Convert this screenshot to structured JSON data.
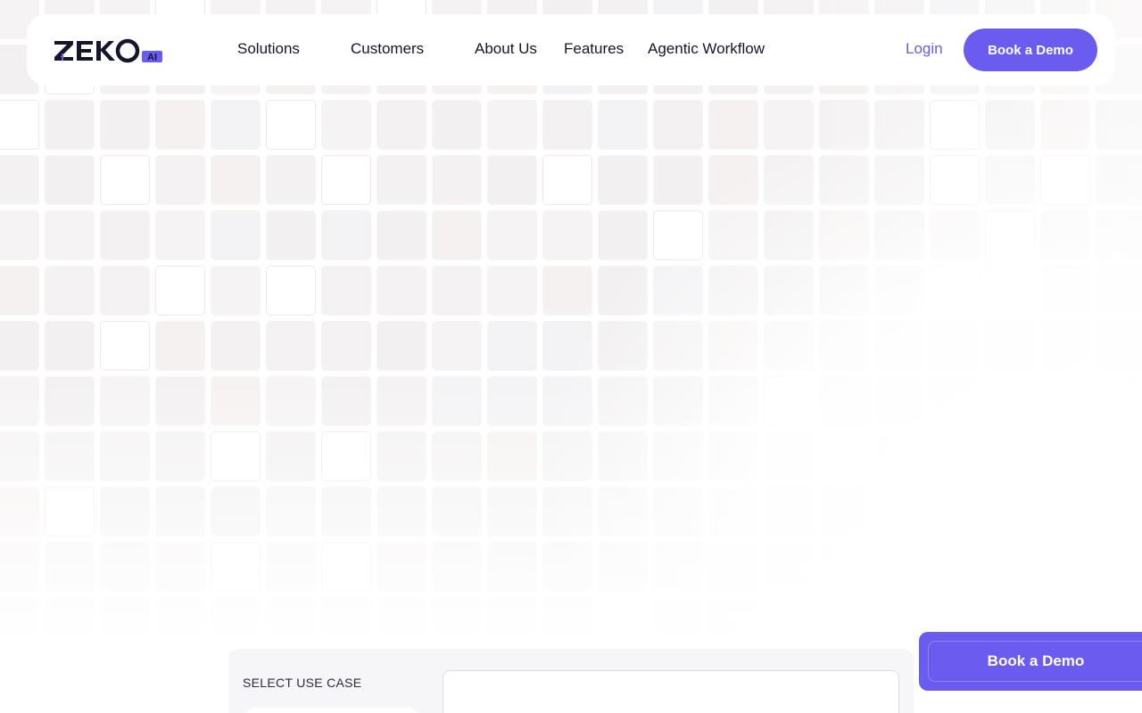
{
  "brand": {
    "name": "ZEKO",
    "suffix": "AI",
    "primary_color": "#6b5cf0",
    "dark_color": "#15152b"
  },
  "nav": {
    "items": [
      {
        "label": "Solutions"
      },
      {
        "label": "Customers"
      },
      {
        "label": "About Us"
      },
      {
        "label": "Features"
      },
      {
        "label": "Agentic Workflow"
      }
    ],
    "login_label": "Login",
    "cta_label": "Book a Demo"
  },
  "usecase": {
    "label": "SELECT USE CASE"
  },
  "floating_cta": {
    "label": "Book a Demo"
  }
}
